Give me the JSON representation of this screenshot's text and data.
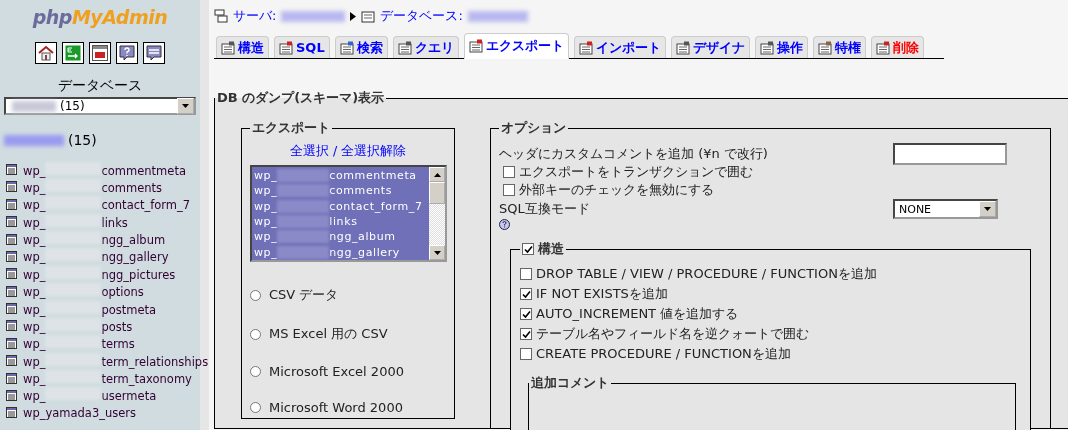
{
  "logo": {
    "php": "php",
    "brand": "MyAdmin"
  },
  "sidebar": {
    "db_label": "データベース",
    "db_select": {
      "value": "(15)"
    },
    "db_heading": {
      "count": "(15)"
    },
    "tables": [
      {
        "kind": "masked",
        "prefix": "wp_",
        "name": "commentmeta"
      },
      {
        "kind": "masked",
        "prefix": "wp_",
        "name": "comments"
      },
      {
        "kind": "masked",
        "prefix": "wp_",
        "name": "contact_form_7"
      },
      {
        "kind": "masked",
        "prefix": "wp_",
        "name": "links"
      },
      {
        "kind": "masked",
        "prefix": "wp_",
        "name": "ngg_album"
      },
      {
        "kind": "masked",
        "prefix": "wp_",
        "name": "ngg_gallery"
      },
      {
        "kind": "masked",
        "prefix": "wp_",
        "name": "ngg_pictures"
      },
      {
        "kind": "masked",
        "prefix": "wp_",
        "name": "options"
      },
      {
        "kind": "masked",
        "prefix": "wp_",
        "name": "postmeta"
      },
      {
        "kind": "masked",
        "prefix": "wp_",
        "name": "posts"
      },
      {
        "kind": "masked",
        "prefix": "wp_",
        "name": "terms"
      },
      {
        "kind": "masked",
        "prefix": "wp_",
        "name": "term_relationships"
      },
      {
        "kind": "masked",
        "prefix": "wp_",
        "name": "term_taxonomy"
      },
      {
        "kind": "masked",
        "prefix": "wp_",
        "name": "usermeta"
      },
      {
        "kind": "plain",
        "prefix": "wp_yamada3_",
        "name": "users"
      }
    ]
  },
  "breadcrumb": {
    "server_label": "サーバ:",
    "database_label": "データベース:"
  },
  "tabs": [
    {
      "label": "構造",
      "selected": false,
      "kind": "normal"
    },
    {
      "label": "SQL",
      "selected": false,
      "kind": "normal"
    },
    {
      "label": "検索",
      "selected": false,
      "kind": "normal"
    },
    {
      "label": "クエリ",
      "selected": false,
      "kind": "normal"
    },
    {
      "label": "エクスポート",
      "selected": true,
      "kind": "normal"
    },
    {
      "label": "インポート",
      "selected": false,
      "kind": "normal"
    },
    {
      "label": "デザイナ",
      "selected": false,
      "kind": "normal"
    },
    {
      "label": "操作",
      "selected": false,
      "kind": "normal"
    },
    {
      "label": "特権",
      "selected": false,
      "kind": "normal"
    },
    {
      "label": "削除",
      "selected": false,
      "kind": "danger"
    }
  ],
  "dump": {
    "title": "DB のダンプ(スキーマ)表示",
    "export": {
      "legend": "エクスポート",
      "select_all": "全選択",
      "separator": "/",
      "deselect_all": "全選択解除",
      "tables": [
        {
          "prefix": "wp_",
          "name": "commentmeta",
          "selected": true
        },
        {
          "prefix": "wp_",
          "name": "comments",
          "selected": true
        },
        {
          "prefix": "wp_",
          "name": "contact_form_7",
          "selected": true
        },
        {
          "prefix": "wp_",
          "name": "links",
          "selected": true
        },
        {
          "prefix": "wp_",
          "name": "ngg_album",
          "selected": true
        },
        {
          "prefix": "wp_",
          "name": "ngg_gallery",
          "selected": true
        }
      ],
      "formats": [
        {
          "label": "CSV データ",
          "selected": false
        },
        {
          "label": "MS Excel 用の CSV",
          "selected": false
        },
        {
          "label": "Microsoft Excel 2000",
          "selected": false
        },
        {
          "label": "Microsoft Word 2000",
          "selected": false
        }
      ]
    },
    "options": {
      "legend": "オプション",
      "header_comment_label": "ヘッダにカスタムコメントを追加 (¥n で改行)",
      "checks": [
        {
          "label": "エクスポートをトランザクションで囲む",
          "checked": false
        },
        {
          "label": "外部キーのチェックを無効にする",
          "checked": false
        }
      ],
      "sql_mode_label": "SQL互換モード",
      "sql_mode": {
        "value": "NONE"
      },
      "structure": {
        "legend": "構造",
        "checked": true,
        "checks": [
          {
            "label": "DROP TABLE / VIEW / PROCEDURE / FUNCTIONを追加",
            "checked": false
          },
          {
            "label": "IF NOT EXISTSを追加",
            "checked": true
          },
          {
            "label": "AUTO_INCREMENT 値を追加する",
            "checked": true
          },
          {
            "label": "テーブル名やフィールド名を逆クォートで囲む",
            "checked": true
          },
          {
            "label": "CREATE PROCEDURE / FUNCTIONを追加",
            "checked": false
          }
        ],
        "comment_legend": "追加コメント"
      }
    }
  }
}
